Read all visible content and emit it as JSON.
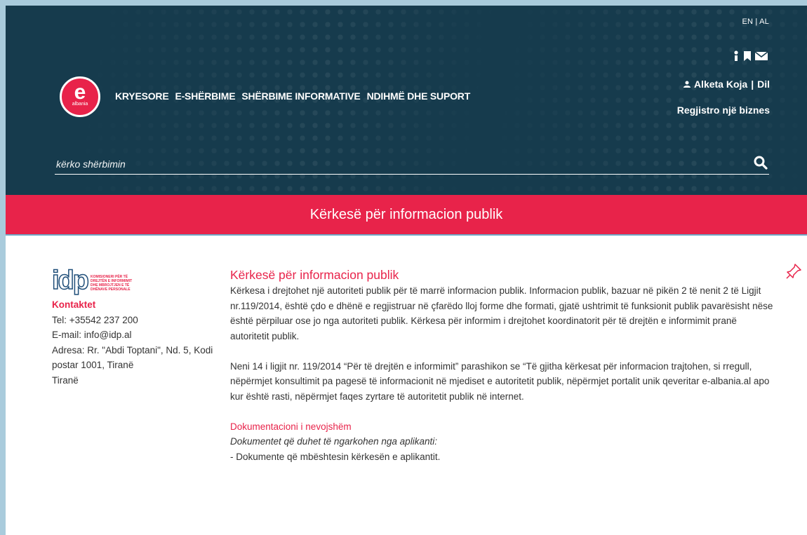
{
  "header": {
    "lang": {
      "en": "EN",
      "sep": " | ",
      "al": "AL"
    },
    "logo": {
      "letter": "e",
      "sub": "albania"
    },
    "nav": [
      "KRYESORE",
      "E-SHËRBIME",
      "SHËRBIME INFORMATIVE",
      "NDIHMË DHE SUPORT"
    ],
    "user_name": "Alketa Koja",
    "user_sep": " | ",
    "logout": "Dil",
    "register": "Regjistro një biznes",
    "search_placeholder": "kërko shërbimin",
    "icons": [
      "info-icon",
      "bookmark-icon",
      "mail-icon",
      "user-icon",
      "search-icon"
    ]
  },
  "banner": {
    "title": "Kërkesë për informacion publik"
  },
  "sidebar": {
    "logo_mark": "idp",
    "logo_text": "KOMISIONERI PËR TË DREJTËN E INFORMIMIT DHE MBROJTJEN E TË DHËNAVE PERSONALE",
    "contacts_title": "Kontaktet",
    "tel": "Tel:  +35542 237 200",
    "email": "E-mail:  info@idp.al",
    "address": "Adresa:  Rr. \"Abdi Toptani\", Nd. 5, Kodi postar 1001, Tiranë",
    "city": "Tiranë"
  },
  "main": {
    "title": "Kërkesë për informacion publik",
    "p1": "Kërkesa i drejtohet një autoriteti publik për të marrë informacion publik. Informacion publik, bazuar në pikën 2 të nenit 2  të Ligjit nr.119/2014,  është çdo e dhënë e regjistruar në çfarëdo lloj forme dhe formati, gjatë ushtrimit të funksionit publik pavarësisht nëse është përpiluar ose jo nga autoriteti publik. Kërkesa për informim i drejtohet koordinatorit për të drejtën e informimit pranë autoritetit publik.",
    "p2": "Neni 14 i ligjit nr. 119/2014 “Për të drejtën e informimit” parashikon se “Të gjitha kërkesat për informacion trajtohen, si rregull, nëpërmjet konsultimit pa pagesë të informacionit në mjediset e autoritetit publik, nëpërmjet portalit unik qeveritar e-albania.al apo kur është rasti, nëpërmjet faqes zyrtare të autoritetit publik në internet.",
    "docs_title": "Dokumentacioni i nevojshëm",
    "docs_intro": "Dokumentet që duhet të ngarkohen nga aplikanti:",
    "docs_item": "- Dokumente që mbështesin kërkesën e aplikantit."
  },
  "colors": {
    "header_bg": "#163b4d",
    "accent": "#e8234a",
    "frame": "#a9cbdc"
  }
}
